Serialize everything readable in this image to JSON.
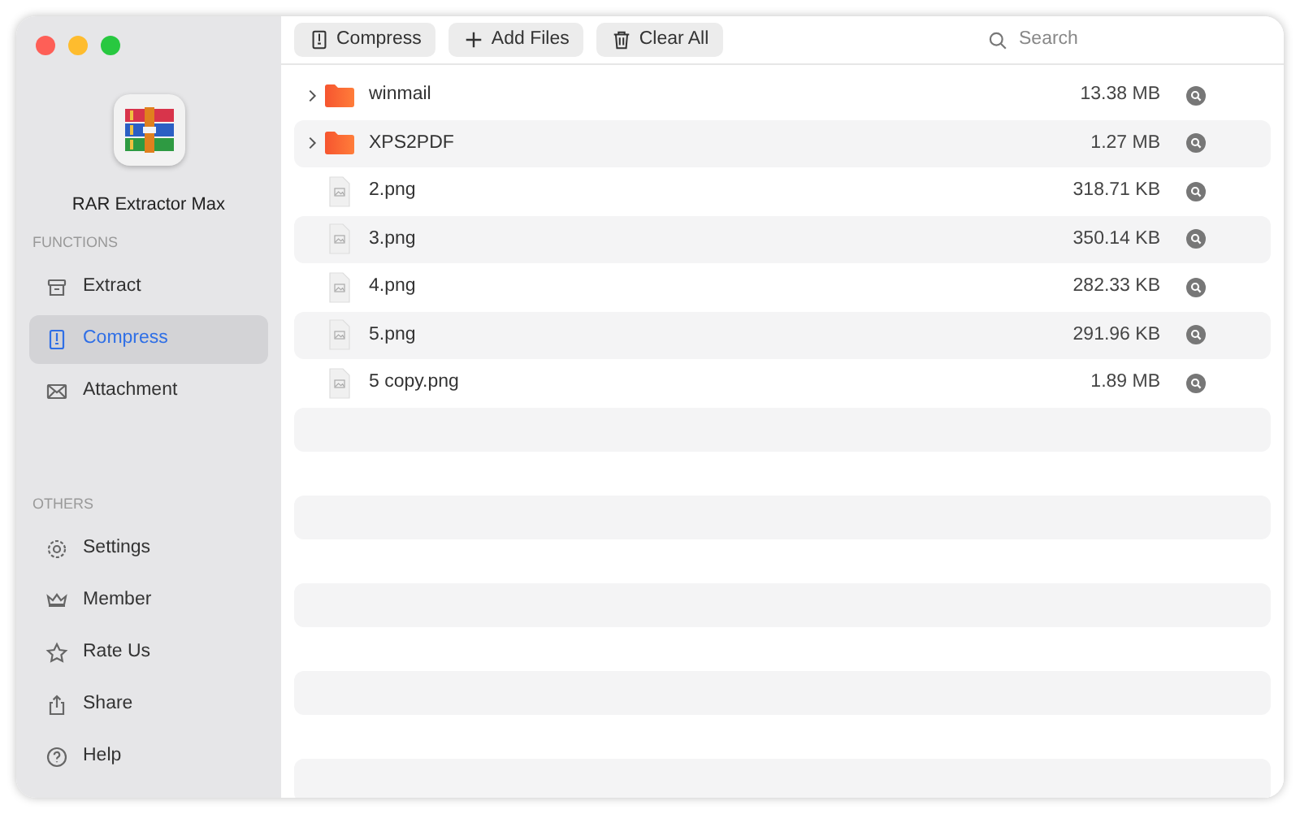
{
  "app": {
    "name": "RAR Extractor Max"
  },
  "sidebar": {
    "sections": [
      {
        "heading": "FUNCTIONS",
        "items": [
          {
            "label": "Extract",
            "selected": false
          },
          {
            "label": "Compress",
            "selected": true
          },
          {
            "label": "Attachment",
            "selected": false
          }
        ]
      },
      {
        "heading": "OTHERS",
        "items": [
          {
            "label": "Settings",
            "selected": false
          },
          {
            "label": "Member",
            "selected": false
          },
          {
            "label": "Rate Us",
            "selected": false
          },
          {
            "label": "Share",
            "selected": false
          },
          {
            "label": "Help",
            "selected": false
          }
        ]
      }
    ]
  },
  "toolbar": {
    "buttons": [
      "Compress",
      "Add Files",
      "Clear All"
    ],
    "search": {
      "placeholder": "Search"
    }
  },
  "files": [
    {
      "kind": "folder",
      "name": "winmail",
      "size": "13.38 MB",
      "expanded": false
    },
    {
      "kind": "folder",
      "name": "XPS2PDF",
      "size": "1.27 MB",
      "expanded": false
    },
    {
      "kind": "file",
      "name": "2.png",
      "size": "318.71 KB"
    },
    {
      "kind": "file",
      "name": "3.png",
      "size": "350.14 KB"
    },
    {
      "kind": "file",
      "name": "4.png",
      "size": "282.33 KB"
    },
    {
      "kind": "file",
      "name": "5.png",
      "size": "291.96 KB"
    },
    {
      "kind": "file",
      "name": "5 copy.png",
      "size": "1.89 MB"
    }
  ]
}
